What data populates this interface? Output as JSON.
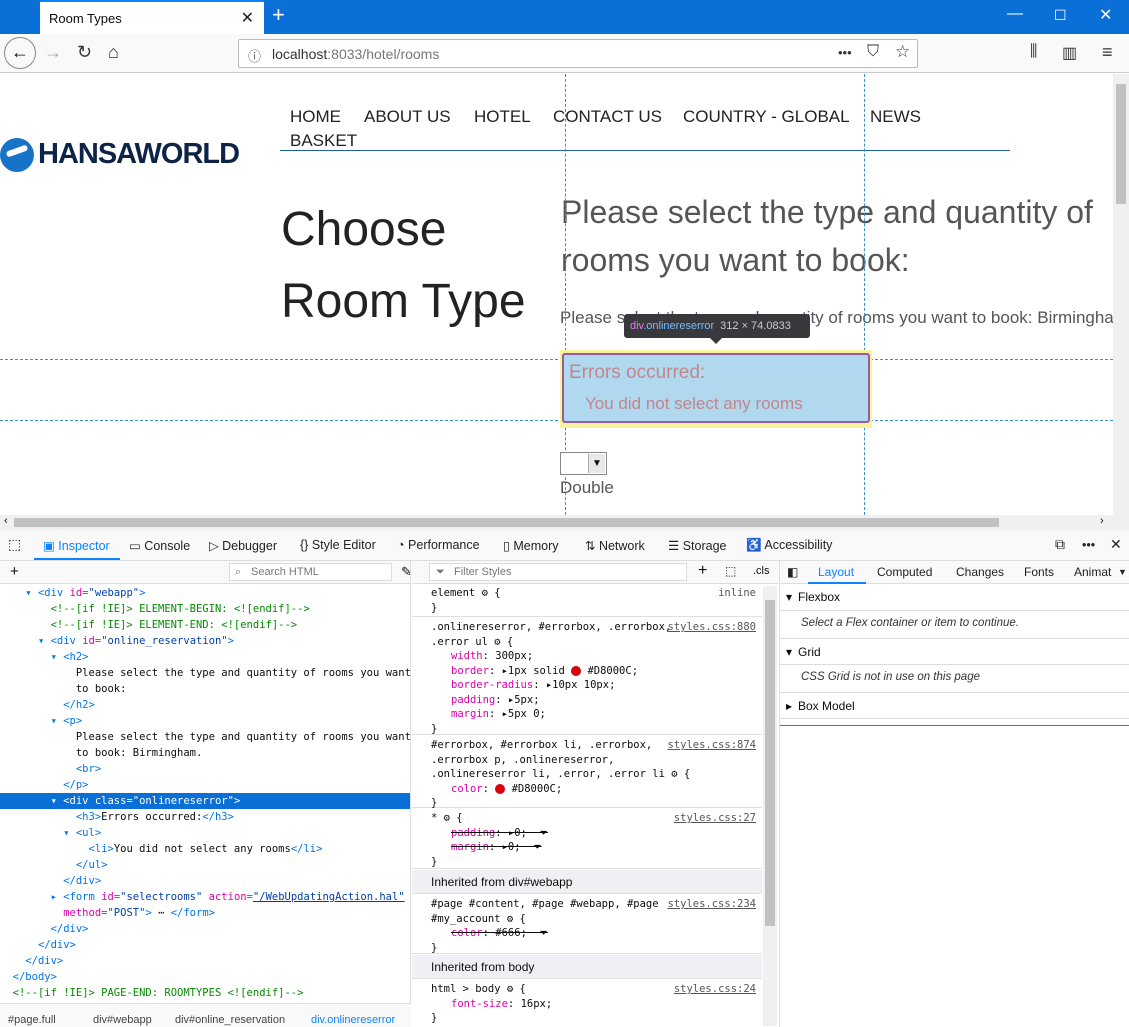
{
  "browser": {
    "tab_title": "Room Types",
    "url_host": "localhost",
    "url_rest": ":8033/hotel/rooms",
    "url_more": "•••"
  },
  "site": {
    "logo": "HANSAWORLD",
    "menu": [
      "HOME",
      "ABOUT US",
      "HOTEL",
      "CONTACT US",
      "COUNTRY - GLOBAL",
      "NEWS",
      "BASKET"
    ],
    "page_title_1": "Choose",
    "page_title_2": "Room Type",
    "h2_line1": "Please select the type and quantity of",
    "h2_line2": "rooms you want to book:",
    "p": "Please select the type and quantity of rooms you want to book: Birmingham.",
    "error_title": "Errors occurred:",
    "error_item": "You did not select any rooms",
    "select_label": "Double"
  },
  "tooltip": {
    "tag": "div",
    "cls": ".onlinereserror",
    "size": "312 × 74.0833"
  },
  "devtools": {
    "tabs": [
      "Inspector",
      "Console",
      "Debugger",
      "Style Editor",
      "Performance",
      "Memory",
      "Network",
      "Storage",
      "Accessibility"
    ],
    "search_placeholder": "Search HTML",
    "filter_placeholder": "Filter Styles",
    "cls_button": ".cls",
    "breadcrumbs": [
      "#page.full",
      "div#webapp",
      "div#online_reservation",
      "div.onlinereserror"
    ],
    "right_tabs": [
      "Layout",
      "Computed",
      "Changes",
      "Fonts",
      "Animat"
    ],
    "layout_sections": [
      {
        "title": "Flexbox",
        "body": "Select a Flex container or item to continue."
      },
      {
        "title": "Grid",
        "body": "CSS Grid is not in use on this page"
      },
      {
        "title": "Box Model",
        "body": ""
      }
    ],
    "inherited_webapp": "Inherited from div#webapp",
    "inherited_body": "Inherited from body"
  },
  "colors": {
    "accent": "#0a84ff",
    "error": "#D8000C",
    "highlight_box": "#b0d8ef",
    "highlight_margin": "#f7f39a"
  }
}
